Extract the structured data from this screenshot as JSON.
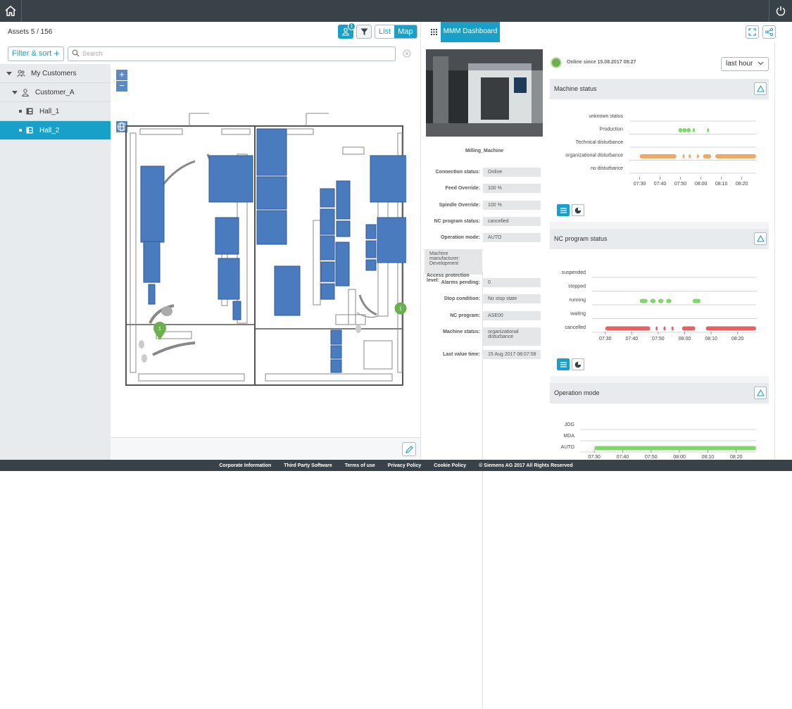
{
  "header": {
    "home_icon": "home-icon",
    "power_icon": "power-icon"
  },
  "assets": {
    "count_label": "Assets 5 / 156",
    "badge": "1",
    "list_label": "List",
    "map_label": "Map"
  },
  "filter": {
    "label": "Filter & sort",
    "search_placeholder": "Search"
  },
  "tree": [
    {
      "label": "My Customers",
      "level": 0,
      "kind": "customers"
    },
    {
      "label": "Customer_A",
      "level": 1,
      "kind": "customer"
    },
    {
      "label": "Hall_1",
      "level": 2,
      "kind": "hall"
    },
    {
      "label": "Hall_2",
      "level": 2,
      "kind": "hall",
      "selected": true
    }
  ],
  "map": {
    "zoom_in": "+",
    "zoom_out": "−",
    "pins": [
      {
        "label": "1"
      },
      {
        "label": "1"
      }
    ]
  },
  "dashboard": {
    "tab_label": "MMM Dashboard"
  },
  "machine": {
    "name": "Milling_Machine",
    "online_text": "Online since 15.08.2017 08:27",
    "time_range": "last hour",
    "properties": [
      {
        "key": "Connection status:",
        "value": "Online"
      },
      {
        "key": "Feed Override:",
        "value": "100 %"
      },
      {
        "key": "Spindle Override:",
        "value": "100 %"
      },
      {
        "key": "NC program status:",
        "value": "cancelled"
      },
      {
        "key": "Operation mode:",
        "value": "AUTO"
      },
      {
        "key": "Access protection level:",
        "value": "Machine manufacturer: Development"
      },
      {
        "key": "Alarms pending:",
        "value": "0"
      },
      {
        "key": "Stop condition:",
        "value": "No stop state"
      },
      {
        "key": "NC program:",
        "value": "ASE00"
      },
      {
        "key": "Machine status:",
        "value": "organizational disturbance"
      },
      {
        "key": "Last value time:",
        "value": "15 Aug 2017 08:07:58"
      }
    ]
  },
  "sections": {
    "machine_status": "Machine status",
    "nc_program_status": "NC program status",
    "operation_mode": "Operation mode"
  },
  "colors": {
    "accent": "#19a0c8",
    "green": "#7fd66a",
    "orange": "#f0a865",
    "red": "#e06464",
    "map_blue": "#4a7bbf"
  },
  "chart_data": [
    {
      "type": "timeline",
      "title": "Machine status",
      "categories": [
        "unknown status",
        "Production",
        "Technical disturbance",
        "organizational disturbance",
        "no disturbance"
      ],
      "x_ticks": [
        "07:30",
        "07:40",
        "07:50",
        "08:00",
        "08:10",
        "08:20"
      ],
      "series": [
        {
          "category": "Production",
          "color": "#7fd66a",
          "segments": [
            [
              "07:49",
              "07:51"
            ],
            [
              "07:51",
              "07:53"
            ],
            [
              "07:53",
              "07:55"
            ],
            [
              "07:56",
              "07:57"
            ],
            [
              "08:03",
              "08:04"
            ]
          ]
        },
        {
          "category": "organizational disturbance",
          "color": "#f0a865",
          "segments": [
            [
              "07:30",
              "07:48"
            ],
            [
              "07:51",
              "07:51.5"
            ],
            [
              "07:54",
              "07:54.5"
            ],
            [
              "07:58",
              "07:58.5"
            ],
            [
              "08:01",
              "08:05"
            ],
            [
              "08:07",
              "08:27"
            ]
          ]
        }
      ]
    },
    {
      "type": "timeline",
      "title": "NC program status",
      "categories": [
        "suspended",
        "stopped",
        "running",
        "waiting",
        "cancelled"
      ],
      "x_ticks": [
        "07:30",
        "07:40",
        "07:50",
        "08:00",
        "08:10",
        "08:20"
      ],
      "series": [
        {
          "category": "running",
          "color": "#7fd66a",
          "segments": [
            [
              "07:43",
              "07:46"
            ],
            [
              "07:47",
              "07:49"
            ],
            [
              "07:50",
              "07:52"
            ],
            [
              "07:53",
              "07:55"
            ],
            [
              "08:03",
              "08:06"
            ]
          ]
        },
        {
          "category": "cancelled",
          "color": "#e06464",
          "segments": [
            [
              "07:30",
              "07:47"
            ],
            [
              "07:49",
              "07:49.5"
            ],
            [
              "07:52",
              "07:52.5"
            ],
            [
              "07:55",
              "07:55.5"
            ],
            [
              "07:59",
              "08:04"
            ],
            [
              "08:08",
              "08:27"
            ]
          ]
        }
      ]
    },
    {
      "type": "timeline",
      "title": "Operation mode",
      "categories": [
        "JOG",
        "MDA",
        "AUTO"
      ],
      "x_ticks": [
        "07:30",
        "07:40",
        "07:50",
        "08:00",
        "08:10",
        "08:20"
      ],
      "series": [
        {
          "category": "AUTO",
          "color": "#7fd66a",
          "segments": [
            [
              "07:30",
              "08:27"
            ]
          ]
        }
      ]
    }
  ],
  "footer": [
    "Corporate Information",
    "Third Party Software",
    "Terms of use",
    "Privacy Policy",
    "Cookie Policy",
    "© Siemens AG 2017 All Rights Reserved"
  ]
}
